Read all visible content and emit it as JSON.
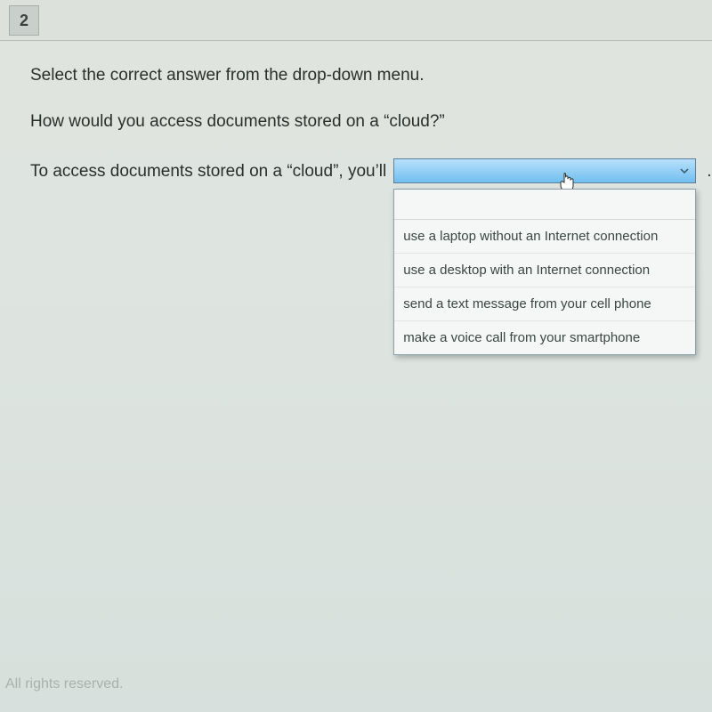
{
  "question_number": "2",
  "instruction": "Select the correct answer from the drop-down menu.",
  "question": "How would you access documents stored on a “cloud?”",
  "answer_prefix": "To access documents stored on a “cloud”, you’ll",
  "dropdown": {
    "selected": "",
    "options": [
      "use a laptop without an Internet connection",
      "use a desktop with an Internet connection",
      "send a text message from your cell phone",
      "make a voice call from your smartphone"
    ]
  },
  "period": ".",
  "footer": "All rights reserved."
}
